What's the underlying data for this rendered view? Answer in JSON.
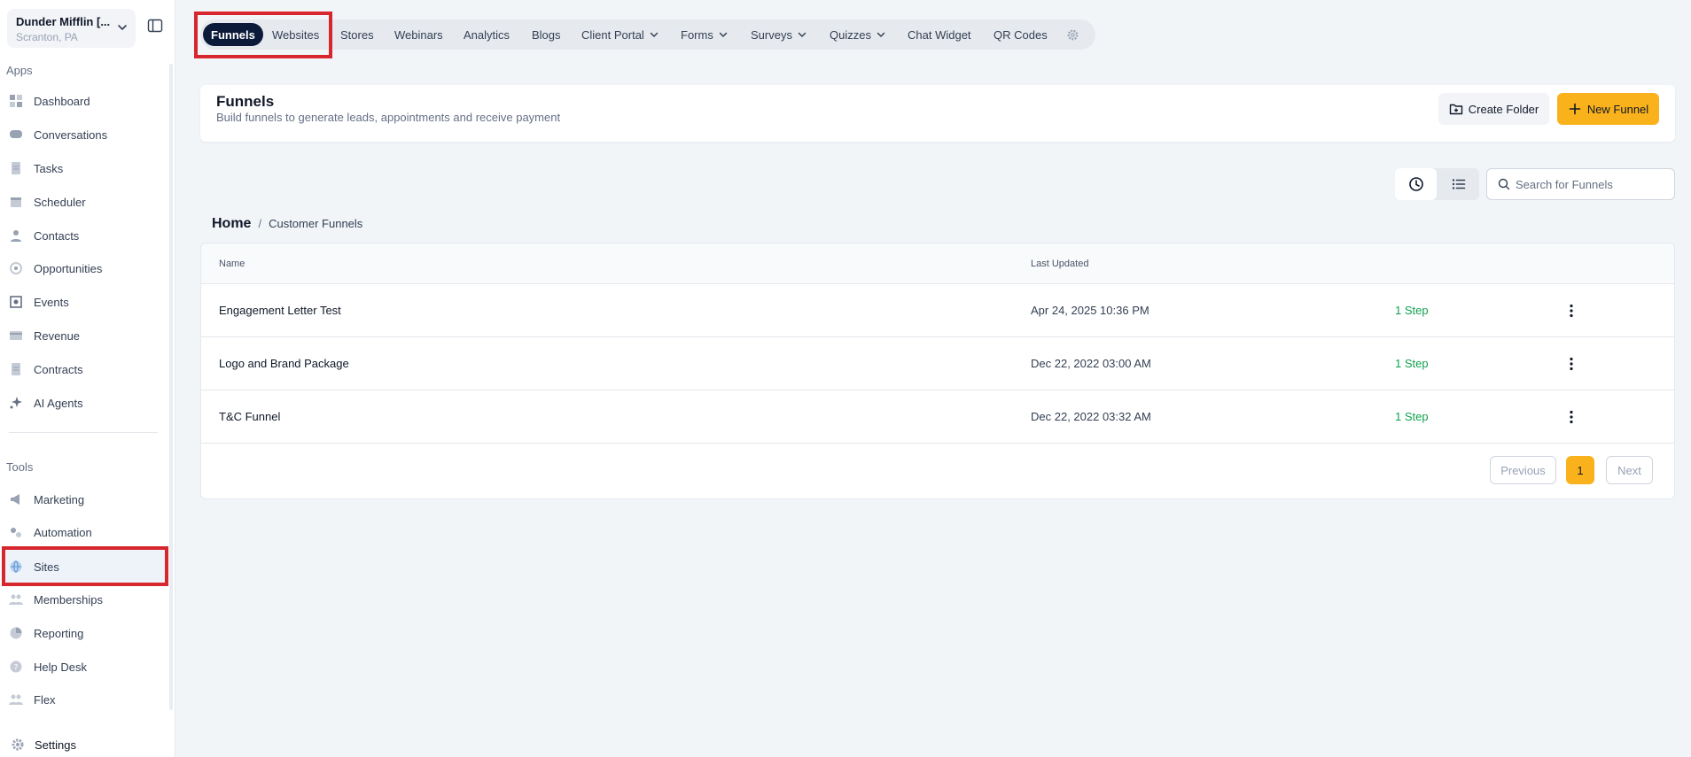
{
  "account": {
    "name": "Dunder Mifflin [...",
    "location": "Scranton, PA"
  },
  "sidebar": {
    "apps_label": "Apps",
    "apps": [
      {
        "label": "Dashboard",
        "icon": "dashboard-icon"
      },
      {
        "label": "Conversations",
        "icon": "chat-icon"
      },
      {
        "label": "Tasks",
        "icon": "document-icon"
      },
      {
        "label": "Scheduler",
        "icon": "calendar-icon"
      },
      {
        "label": "Contacts",
        "icon": "person-icon"
      },
      {
        "label": "Opportunities",
        "icon": "target-icon"
      },
      {
        "label": "Events",
        "icon": "event-icon"
      },
      {
        "label": "Revenue",
        "icon": "card-icon"
      },
      {
        "label": "Contracts",
        "icon": "document-icon"
      },
      {
        "label": "AI Agents",
        "icon": "sparkle-icon"
      }
    ],
    "tools_label": "Tools",
    "tools": [
      {
        "label": "Marketing",
        "icon": "megaphone-icon"
      },
      {
        "label": "Automation",
        "icon": "gears-icon"
      },
      {
        "label": "Sites",
        "icon": "globe-icon"
      },
      {
        "label": "Memberships",
        "icon": "people-icon"
      },
      {
        "label": "Reporting",
        "icon": "pie-icon"
      },
      {
        "label": "Help Desk",
        "icon": "help-icon"
      },
      {
        "label": "Flex",
        "icon": "people-icon"
      }
    ],
    "settings": "Settings"
  },
  "topnav": {
    "tabs": [
      {
        "label": "Funnels",
        "active": true
      },
      {
        "label": "Websites"
      },
      {
        "label": "Stores"
      },
      {
        "label": "Webinars"
      },
      {
        "label": "Analytics"
      },
      {
        "label": "Blogs"
      },
      {
        "label": "Client Portal",
        "dropdown": true
      },
      {
        "label": "Forms",
        "dropdown": true
      },
      {
        "label": "Surveys",
        "dropdown": true
      },
      {
        "label": "Quizzes",
        "dropdown": true
      },
      {
        "label": "Chat Widget"
      },
      {
        "label": "QR Codes"
      }
    ]
  },
  "header": {
    "title": "Funnels",
    "subtitle": "Build funnels to generate leads, appointments and receive payment",
    "create_folder": "Create Folder",
    "new_funnel": "New Funnel"
  },
  "search": {
    "placeholder": "Search for Funnels",
    "value": ""
  },
  "breadcrumb": {
    "home": "Home",
    "separator": "/",
    "current": "Customer Funnels"
  },
  "table": {
    "columns": {
      "name": "Name",
      "last_updated": "Last Updated"
    },
    "rows": [
      {
        "name": "Engagement Letter Test",
        "last_updated": "Apr 24, 2025 10:36 PM",
        "steps": "1 Step"
      },
      {
        "name": "Logo and Brand Package",
        "last_updated": "Dec 22, 2022 03:00 AM",
        "steps": "1 Step"
      },
      {
        "name": "T&C Funnel",
        "last_updated": "Dec 22, 2022 03:32 AM",
        "steps": "1 Step"
      }
    ]
  },
  "pagination": {
    "previous": "Previous",
    "page": "1",
    "next": "Next"
  },
  "colors": {
    "accent": "#f9b21b",
    "nav_active": "#0c1a3a",
    "success": "#12a150",
    "highlight": "#d7262d"
  }
}
